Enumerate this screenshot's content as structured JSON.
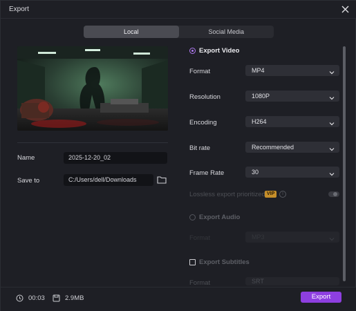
{
  "window": {
    "title": "Export"
  },
  "tabs": [
    {
      "label": "Local",
      "active": true
    },
    {
      "label": "Social Media",
      "active": false
    }
  ],
  "left": {
    "name_label": "Name",
    "name_value": "2025-12-20_02",
    "save_label": "Save to",
    "save_value": "C:/Users/dell/Downloads"
  },
  "right": {
    "export_video_label": "Export Video",
    "rows": [
      {
        "label": "Format",
        "value": "MP4"
      },
      {
        "label": "Resolution",
        "value": "1080P"
      },
      {
        "label": "Encoding",
        "value": "H264"
      },
      {
        "label": "Bit rate",
        "value": "Recommended"
      },
      {
        "label": "Frame Rate",
        "value": "30"
      }
    ],
    "lossless_label": "Lossless export prioritized",
    "vip_badge": "VIP",
    "info_glyph": "i",
    "export_audio_label": "Export Audio",
    "audio_format_label": "Format",
    "audio_format_value": "MP3",
    "export_subtitles_label": "Export Subtitles",
    "subtitle_format_label": "Format",
    "subtitle_format_value": "SRT"
  },
  "footer": {
    "duration": "00:03",
    "size": "2.9MB",
    "export_label": "Export"
  },
  "icons": {
    "close": "close-icon",
    "folder": "folder-icon",
    "clock": "clock-icon",
    "file_size": "file-size-icon",
    "chevron": "chevron-down-icon"
  },
  "colors": {
    "accent": "#8e3fe0",
    "radio_accent": "#b07af0",
    "vip": "#c58e2a",
    "background": "#1e1f25"
  }
}
